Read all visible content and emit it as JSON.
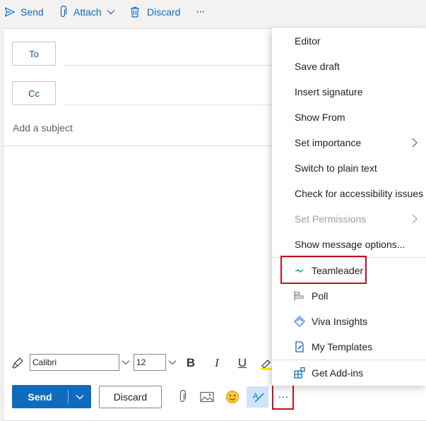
{
  "toolbar": {
    "send": "Send",
    "attach": "Attach",
    "discard": "Discard",
    "more": "···"
  },
  "compose": {
    "to_label": "To",
    "cc_label": "Cc",
    "subject_placeholder": "Add a subject"
  },
  "format_bar": {
    "font": "Calibri",
    "size": "12",
    "bold": "B",
    "italic": "I",
    "underline": "U"
  },
  "actions": {
    "send": "Send",
    "discard": "Discard",
    "more": "···"
  },
  "menu": {
    "items": [
      {
        "label": "Editor"
      },
      {
        "label": "Save draft"
      },
      {
        "label": "Insert signature"
      },
      {
        "label": "Show From"
      },
      {
        "label": "Set importance"
      },
      {
        "label": "Switch to plain text"
      },
      {
        "label": "Check for accessibility issues"
      },
      {
        "label": "Set Permissions"
      },
      {
        "label": "Show message options..."
      }
    ],
    "addins": [
      {
        "label": "Teamleader",
        "icon": "teamleader-icon"
      },
      {
        "label": "Poll",
        "icon": "poll-icon"
      },
      {
        "label": "Viva Insights",
        "icon": "viva-insights-icon"
      },
      {
        "label": "My Templates",
        "icon": "my-templates-icon"
      }
    ],
    "get_addins": "Get Add-ins"
  },
  "colors": {
    "accent": "#0f6cbd",
    "highlight_border": "#c50f1f",
    "teamleader": "#00b2a0"
  }
}
